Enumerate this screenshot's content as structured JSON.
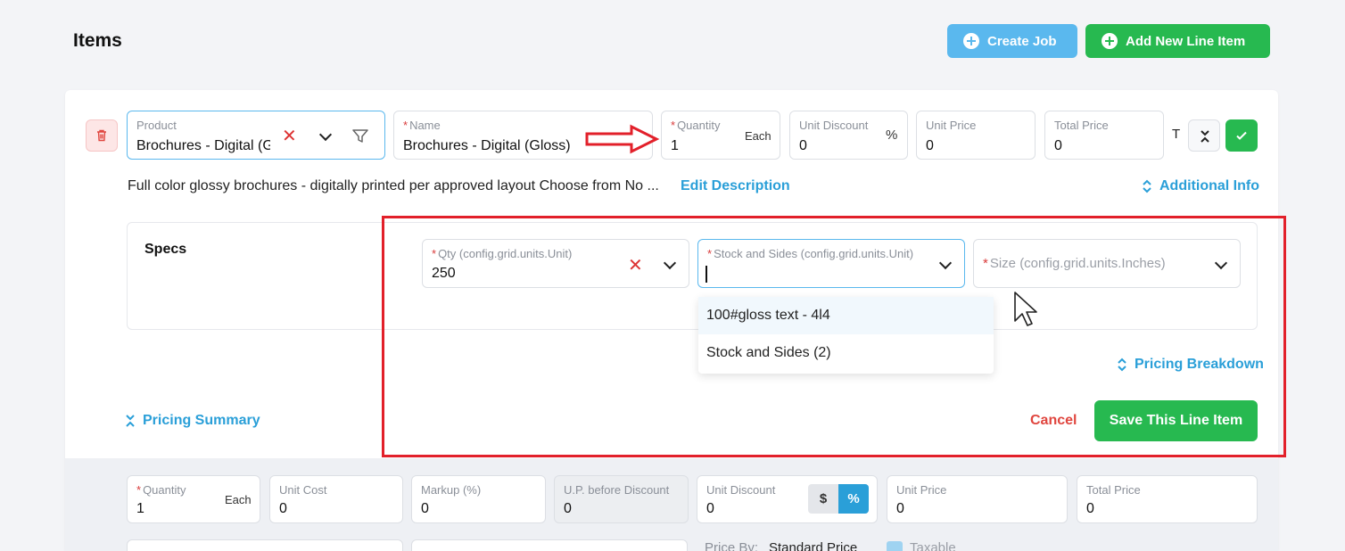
{
  "header": {
    "title": "Items",
    "create_job_label": "Create Job",
    "add_line_item_label": "Add New Line Item"
  },
  "line_item": {
    "product": {
      "label": "Product",
      "value": "Brochures - Digital (Gloss)"
    },
    "name": {
      "label": "Name",
      "value": "Brochures - Digital (Gloss)"
    },
    "quantity": {
      "label": "Quantity",
      "value": "1",
      "unit": "Each"
    },
    "unit_discount": {
      "label": "Unit Discount",
      "value": "0",
      "unit": "%"
    },
    "unit_price": {
      "label": "Unit Price",
      "value": "0"
    },
    "total_price": {
      "label": "Total Price",
      "value": "0"
    },
    "t_label": "T",
    "description": "Full color glossy brochures - digitally printed per approved layout Choose from No ...",
    "edit_description_label": "Edit Description",
    "additional_info_label": "Additional Info"
  },
  "specs": {
    "title": "Specs",
    "qty": {
      "label": "Qty (config.grid.units.Unit)",
      "value": "250"
    },
    "stock_sides": {
      "label": "Stock and Sides (config.grid.units.Unit)",
      "value": ""
    },
    "size": {
      "placeholder": "Size (config.grid.units.Inches)"
    },
    "dropdown_options": [
      "100#gloss text - 4l4",
      "Stock and Sides (2)"
    ]
  },
  "actions": {
    "pricing_breakdown_label": "Pricing Breakdown",
    "pricing_summary_label": "Pricing Summary",
    "cancel_label": "Cancel",
    "save_label": "Save This Line Item"
  },
  "pricing": {
    "quantity": {
      "label": "Quantity",
      "value": "1",
      "unit": "Each"
    },
    "unit_cost": {
      "label": "Unit Cost",
      "value": "0"
    },
    "markup": {
      "label": "Markup (%)",
      "value": "0"
    },
    "up_before_discount": {
      "label": "U.P. before Discount",
      "value": "0"
    },
    "unit_discount": {
      "label": "Unit Discount",
      "value": "0",
      "dollar": "$",
      "percent": "%"
    },
    "unit_price": {
      "label": "Unit Price",
      "value": "0"
    },
    "total_price": {
      "label": "Total Price",
      "value": "0"
    },
    "price_by_label": "Price By:",
    "price_by_value": "Standard Price",
    "taxable_label": "Taxable"
  },
  "colors": {
    "primary_blue": "#5ab8ee",
    "green": "#27b950",
    "link": "#2a9fd8",
    "danger": "#e0463f",
    "annotation_red": "#e2202a"
  }
}
